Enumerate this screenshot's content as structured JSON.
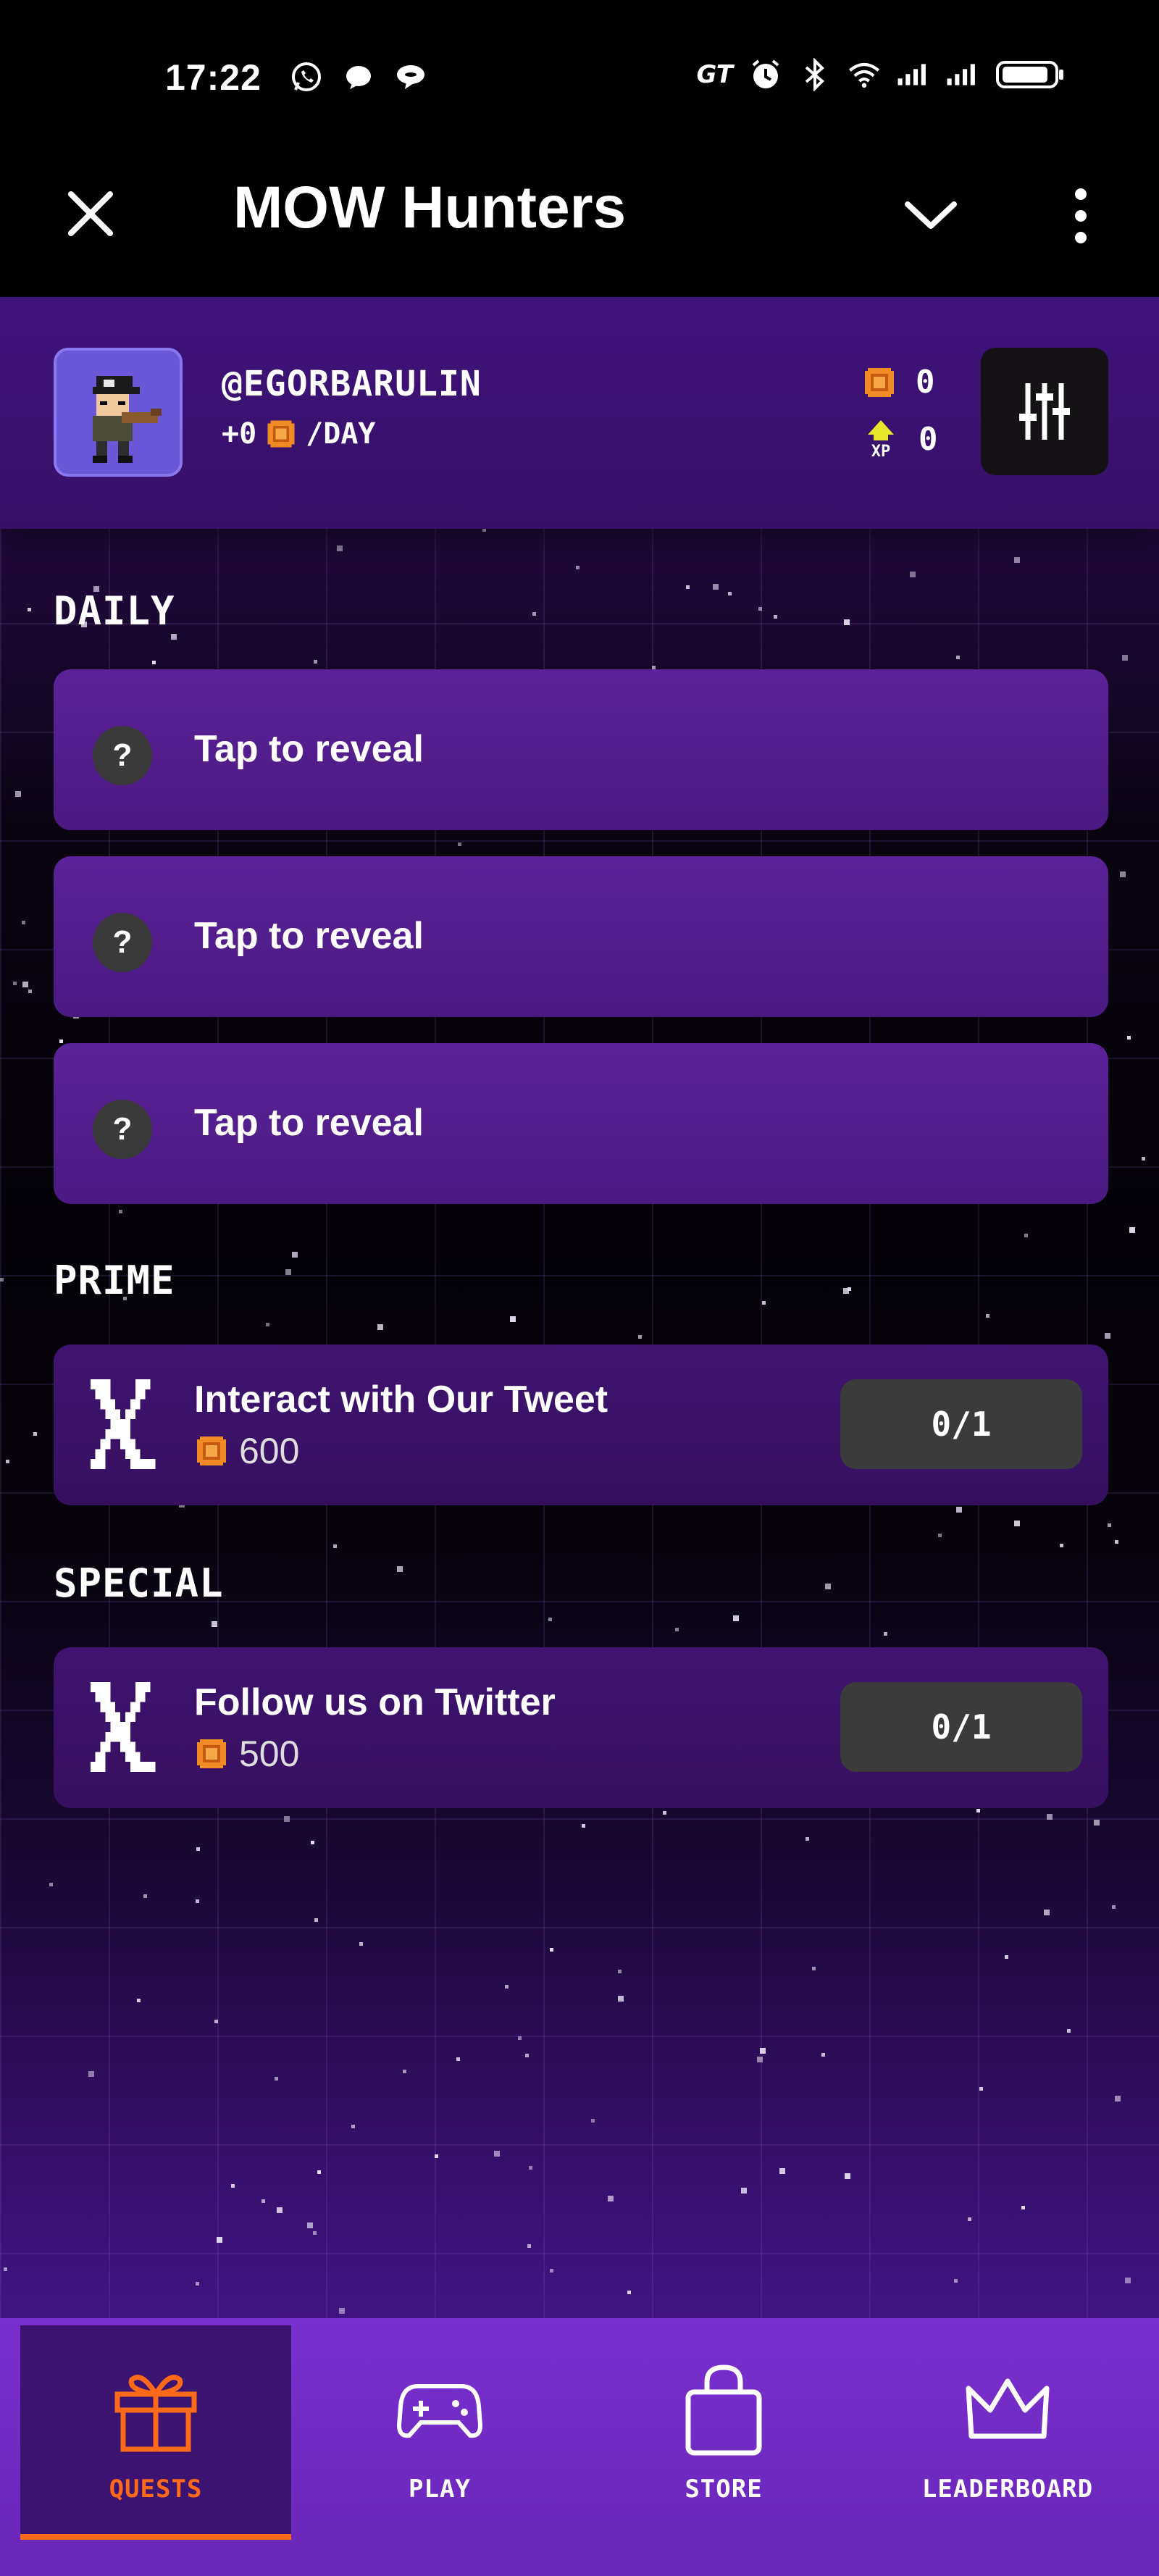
{
  "status_bar": {
    "time": "17:22",
    "left_icons": [
      "whatsapp-icon",
      "chat-bubble-icon",
      "chat-bubbles-icon"
    ],
    "right_icons": [
      "gt-icon",
      "alarm-icon",
      "bluetooth-icon",
      "wifi-icon",
      "signal-icon",
      "signal-icon",
      "battery-icon"
    ],
    "gt_text": "GT"
  },
  "app_bar": {
    "title": "MOW Hunters"
  },
  "user": {
    "username": "@EGORBARULIN",
    "per_day_prefix": "+0",
    "per_day_suffix": "/DAY",
    "coins": "0",
    "xp": "0",
    "xp_label": "XP"
  },
  "sections": {
    "daily": "DAILY",
    "prime": "PRIME",
    "special": "SPECIAL"
  },
  "daily": [
    {
      "label": "Tap to reveal",
      "badge": "?"
    },
    {
      "label": "Tap to reveal",
      "badge": "?"
    },
    {
      "label": "Tap to reveal",
      "badge": "?"
    }
  ],
  "prime": [
    {
      "title": "Interact with Our Tweet",
      "reward": "600",
      "progress": "0/1"
    }
  ],
  "special": [
    {
      "title": "Follow us on Twitter",
      "reward": "500",
      "progress": "0/1"
    }
  ],
  "nav": {
    "quests": "QUESTS",
    "play": "PLAY",
    "store": "STORE",
    "leaderboard": "LEADERBOARD",
    "active": "quests"
  },
  "colors": {
    "accent": "#ff6a1a",
    "card": "#5c2298",
    "nav": "#7a2fd0",
    "coin": "#f08a24"
  }
}
